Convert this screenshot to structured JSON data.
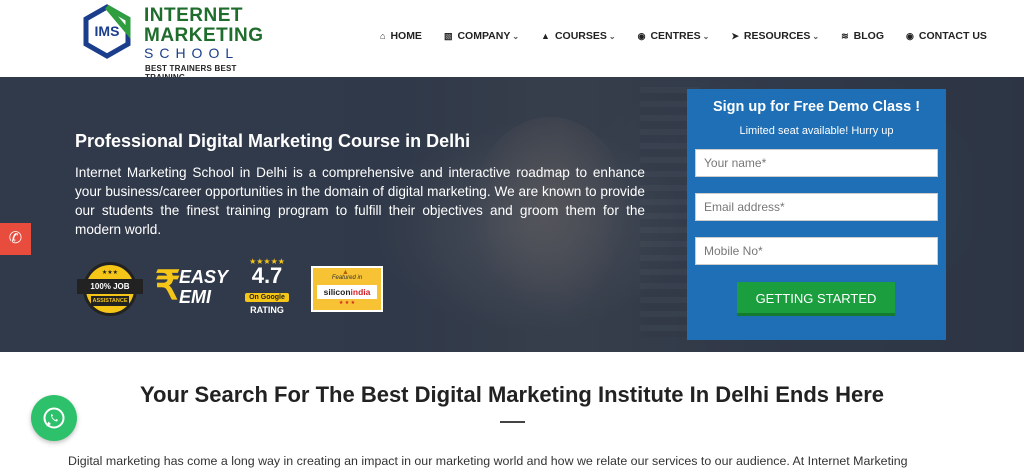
{
  "brand": {
    "logo_line1": "INTERNET",
    "logo_line2": "MARKETING",
    "logo_line3": "SCHOOL",
    "logo_mark": "IMS",
    "tagline": "BEST TRAINERS BEST TRAINING"
  },
  "nav": {
    "items": [
      {
        "label": "HOME",
        "icon": "home-icon",
        "dropdown": false
      },
      {
        "label": "COMPANY",
        "icon": "building-icon",
        "dropdown": true
      },
      {
        "label": "COURSES",
        "icon": "graduation-cap-icon",
        "dropdown": true
      },
      {
        "label": "CENTRES",
        "icon": "globe-icon",
        "dropdown": true
      },
      {
        "label": "RESOURCES",
        "icon": "rocket-icon",
        "dropdown": true
      },
      {
        "label": "BLOG",
        "icon": "rss-icon",
        "dropdown": false
      },
      {
        "label": "CONTACT US",
        "icon": "globe-icon",
        "dropdown": false
      }
    ]
  },
  "hero": {
    "title": "Professional Digital Marketing Course in Delhi",
    "description": "Internet Marketing School in Delhi is a comprehensive and interactive roadmap to enhance your business/career opportunities in the domain of digital marketing. We are known to provide our students the finest training program to fulfill their objectives and groom them for the modern world.",
    "badges": {
      "job_line1": "100% JOB",
      "job_line2": "ASSISTANCE",
      "emi_line1": "EASY",
      "emi_line2": "EMI",
      "rating_value": "4.7",
      "rating_source": "On Google",
      "rating_label": "RATING",
      "featured_text": "Featured in",
      "featured_name_a": "silicon",
      "featured_name_b": "india"
    }
  },
  "form": {
    "title": "Sign up for Free Demo Class !",
    "subtitle": "Limited seat available! Hurry up",
    "name_placeholder": "Your name*",
    "email_placeholder": "Email address*",
    "mobile_placeholder": "Mobile No*",
    "submit_label": "GETTING STARTED"
  },
  "section": {
    "title": "Your Search For The Best Digital Marketing Institute In Delhi Ends Here",
    "body": "Digital marketing has come a long way in creating an impact in our marketing world and how we relate our services to our audience. At Internet Marketing"
  },
  "colors": {
    "brand_green": "#1f6d2c",
    "brand_blue": "#1a3e8c",
    "form_blue": "#1e6fb5",
    "cta_green": "#1b9e3e",
    "phone_red": "#e84c3d",
    "whatsapp_green": "#2ec16b"
  }
}
